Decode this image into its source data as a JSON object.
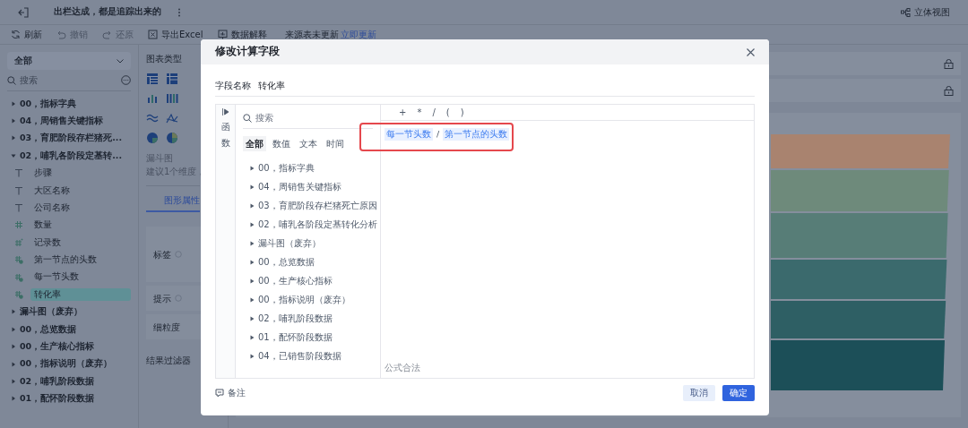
{
  "header": {
    "title": "出栏达成，都是追踪出来的",
    "view_button": "立体视图"
  },
  "toolbar": [
    {
      "label": "刷新",
      "disabled": false
    },
    {
      "label": "撤销",
      "disabled": true
    },
    {
      "label": "还原",
      "disabled": true
    },
    {
      "label": "导出Excel",
      "disabled": false
    },
    {
      "label": "数据解释",
      "disabled": false
    }
  ],
  "source_notice": {
    "text": "来源表未更新",
    "link": "立即更新"
  },
  "sidebar": {
    "dataset": "全部",
    "search_placeholder": "搜索",
    "tree": [
      {
        "label": "00，指标字典",
        "expanded": false
      },
      {
        "label": "04，周销售关键指标",
        "expanded": false
      },
      {
        "label": "03，育肥阶段存栏猪死...",
        "expanded": false
      },
      {
        "label": "02，哺乳各阶段定基转...",
        "expanded": true,
        "children": [
          {
            "label": "步骤",
            "kind": "text",
            "selected": false
          },
          {
            "label": "大区名称",
            "kind": "text",
            "selected": false
          },
          {
            "label": "公司名称",
            "kind": "text",
            "selected": false
          },
          {
            "label": "数量",
            "kind": "number",
            "selected": false
          },
          {
            "label": "记录数",
            "kind": "count",
            "selected": false
          },
          {
            "label": "第一节点的头数",
            "kind": "calc",
            "selected": false
          },
          {
            "label": "每一节头数",
            "kind": "calc",
            "selected": false
          },
          {
            "label": "转化率",
            "kind": "calc",
            "selected": true
          }
        ]
      },
      {
        "label": "漏斗图（废弃）",
        "expanded": false
      },
      {
        "label": "00，总览数据",
        "expanded": false
      },
      {
        "label": "00，生产核心指标",
        "expanded": false
      },
      {
        "label": "00，指标说明（废弃）",
        "expanded": false
      },
      {
        "label": "02，哺乳阶段数据",
        "expanded": false
      },
      {
        "label": "01，配怀阶段数据",
        "expanded": false
      }
    ]
  },
  "chart_panel": {
    "title": "图表类型",
    "chart_name": "漏斗图",
    "chart_hint": "建议1个维度，",
    "tab": "图形属性",
    "properties": [
      {
        "label": "标签",
        "help": true
      },
      {
        "label": "提示",
        "help": true
      },
      {
        "label": "细粒度",
        "help": false
      }
    ],
    "filter_title": "结果过滤器"
  },
  "dialog": {
    "title": "修改计算字段",
    "field_label": "字段名称",
    "field_value": "转化率",
    "side_tab": "函数",
    "search_placeholder": "搜索",
    "filter_tabs": [
      {
        "label": "全部",
        "selected": true
      },
      {
        "label": "数值",
        "selected": false
      },
      {
        "label": "文本",
        "selected": false
      },
      {
        "label": "时间",
        "selected": false
      }
    ],
    "tables": [
      "00，指标字典",
      "04，周销售关键指标",
      "03，育肥阶段存栏猪死亡原因",
      "02，哺乳各阶段定基转化分析",
      "漏斗图（废弃）",
      "00，总览数据",
      "00，生产核心指标",
      "00，指标说明（废弃）",
      "02，哺乳阶段数据",
      "01，配怀阶段数据",
      "04，已销售阶段数据"
    ],
    "operators": [
      "+",
      "*",
      "/",
      "(",
      ")"
    ],
    "formula": [
      {
        "kind": "field",
        "text": "每一节头数"
      },
      {
        "kind": "operator",
        "text": "/"
      },
      {
        "kind": "field",
        "text": "第一节点的头数"
      }
    ],
    "highlighted": true,
    "status": "公式合法",
    "note": "备注",
    "buttons": [
      {
        "label": "取消",
        "kind": "secondary"
      },
      {
        "label": "确定",
        "kind": "primary"
      }
    ]
  }
}
